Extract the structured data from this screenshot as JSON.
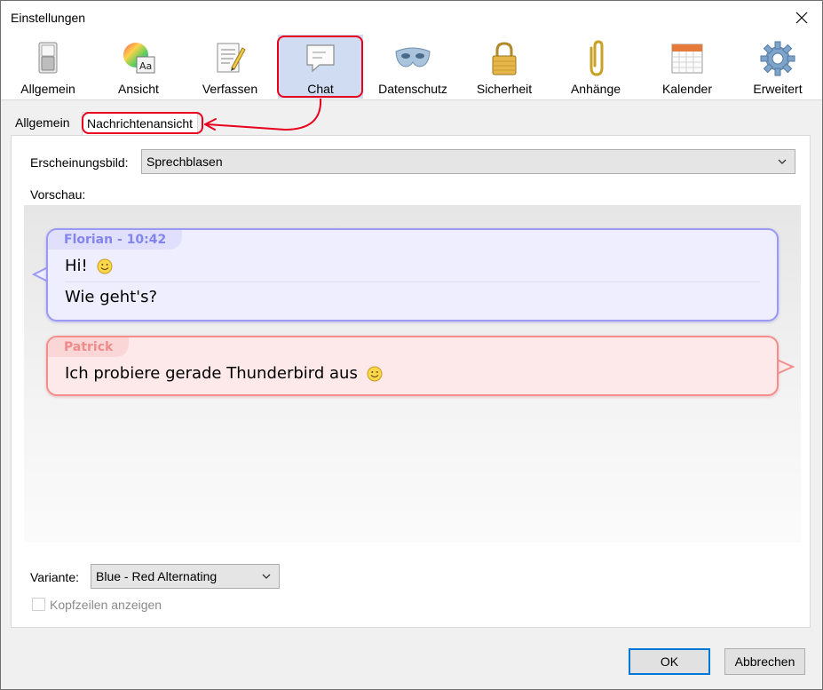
{
  "window": {
    "title": "Einstellungen"
  },
  "toolbar": {
    "items": [
      {
        "label": "Allgemein",
        "icon": "switch-icon"
      },
      {
        "label": "Ansicht",
        "icon": "color-palette-icon"
      },
      {
        "label": "Verfassen",
        "icon": "document-pen-icon"
      },
      {
        "label": "Chat",
        "icon": "chat-bubble-icon",
        "selected": true
      },
      {
        "label": "Datenschutz",
        "icon": "mask-icon"
      },
      {
        "label": "Sicherheit",
        "icon": "padlock-icon"
      },
      {
        "label": "Anhänge",
        "icon": "paperclip-icon"
      },
      {
        "label": "Kalender",
        "icon": "calendar-icon"
      },
      {
        "label": "Erweitert",
        "icon": "gear-icon"
      }
    ]
  },
  "subtabs": [
    {
      "label": "Allgemein",
      "active": false
    },
    {
      "label": "Nachrichtenansicht",
      "active": true
    }
  ],
  "appearance": {
    "label": "Erscheinungsbild:",
    "value": "Sprechblasen"
  },
  "preview": {
    "label": "Vorschau:",
    "messages": [
      {
        "nick": "Florian - 10:42",
        "lines": [
          "Hi!",
          "Wie geht's?"
        ],
        "color": "#9a9af2"
      },
      {
        "nick": "Patrick",
        "lines": [
          "Ich probiere gerade Thunderbird aus"
        ],
        "color": "#f28e8e"
      }
    ]
  },
  "variant": {
    "label": "Variante:",
    "value": "Blue - Red Alternating"
  },
  "headers_checkbox": {
    "label": "Kopfzeilen anzeigen",
    "checked": false,
    "disabled": true
  },
  "buttons": {
    "ok": "OK",
    "cancel": "Abbrechen"
  },
  "colors": {
    "highlight": "#e8001c",
    "selected_tab": "#cfdcf2",
    "default_button_border": "#0078d7"
  }
}
